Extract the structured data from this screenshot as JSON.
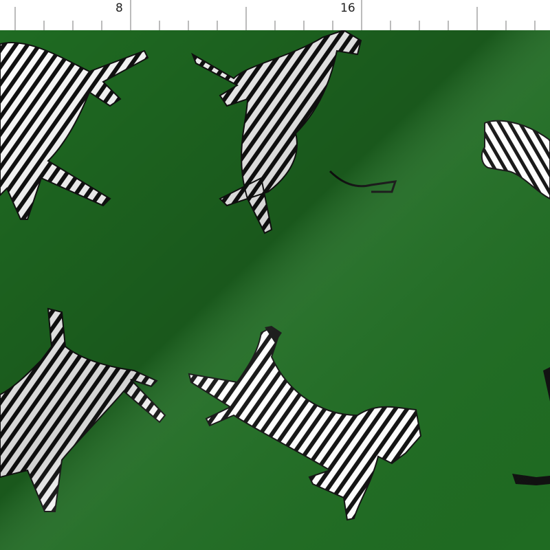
{
  "ruler": {
    "labels": [
      "8",
      "16"
    ]
  },
  "fabric": {
    "background_color": "#1f6b22",
    "motif": "zebra"
  },
  "colors": {
    "stripe": "#111111",
    "body": "#ffffff",
    "ruler_line": "#888888"
  }
}
